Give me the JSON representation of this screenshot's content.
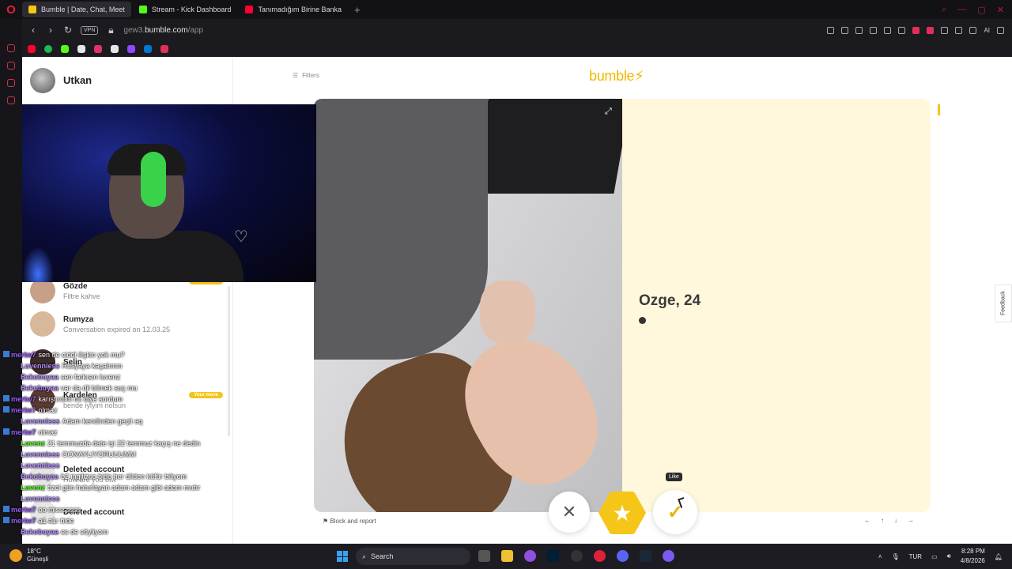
{
  "browser": {
    "tabs": [
      {
        "label": "Bumble | Date, Chat, Meet",
        "active": true,
        "color": "#f5c518"
      },
      {
        "label": "Stream - Kick Dashboard",
        "active": false,
        "color": "#53fc18"
      },
      {
        "label": "Tanımadığım Birine Banka",
        "active": false,
        "color": "#ff0033"
      }
    ],
    "vpn_label": "VPN",
    "url_prefix": "gew3.",
    "url_domain": "bumble.com",
    "url_path": "/app",
    "ai_label": "AI",
    "bookmark_colors": [
      "#ff0033",
      "#1db954",
      "#53fc18",
      "#e6e6ea",
      "#e1306c",
      "#e6e6ea",
      "#9146ff",
      "#0078d4",
      "#e0305a"
    ]
  },
  "sidebar": {
    "user_name": "Utkan",
    "conversations": [
      {
        "name": "Gözde",
        "sub": "Filtre kahve",
        "badge": "Your move"
      },
      {
        "name": "Rumyza",
        "sub": "Conversation expired on 12.03.25",
        "badge": ""
      },
      {
        "name": "Selin",
        "sub": "",
        "badge": ""
      },
      {
        "name": "Kardelen",
        "sub": "bende iyiyim nolsun",
        "badge": "Your move"
      },
      {
        "name": "Deleted account",
        "sub": "How are you btw",
        "badge": ""
      },
      {
        "name": "Deleted account",
        "sub": "",
        "badge": ""
      }
    ]
  },
  "chat_overlay": [
    {
      "user": "mertw7",
      "color": "#9b5cff",
      "msg": "sen de ciddi ilişkin yok mu?"
    },
    {
      "user": "Luvenniess",
      "color": "#b48cff",
      "msg": "Rusyaya kaçalımm"
    },
    {
      "user": "Bekobuyaa",
      "color": "#b48cff",
      "msg": "sen farkısın luvenz"
    },
    {
      "user": "Bekobuyaa",
      "color": "#b48cff",
      "msg": "var da dil bilmek suç mu"
    },
    {
      "user": "mertw7",
      "color": "#9b5cff",
      "msg": "karıştırdım mı diye sordum"
    },
    {
      "user": "mertw7",
      "color": "#9b5cff",
      "msg": "olmaz"
    },
    {
      "user": "Luvenniess",
      "color": "#b48cff",
      "msg": "Adam kendinden geçti aq"
    },
    {
      "user": "mertw7",
      "color": "#9b5cff",
      "msg": "olmaz"
    },
    {
      "user": "Luvenz",
      "color": "#53fc18",
      "msg": "21 temmuzda date işi 22 temmuz kaçış ne dedin"
    },
    {
      "user": "Luvenniess",
      "color": "#b48cff",
      "msg": "OONAYLIYORUUUMM"
    },
    {
      "user": "Luvenniess",
      "color": "#b48cff",
      "msg": ""
    },
    {
      "user": "Bekobuyaa",
      "color": "#b48cff",
      "msg": "b2 ingilizce bide her dilden küfür biliyom"
    },
    {
      "user": "Luvenz",
      "color": "#53fc18",
      "msg": "özel gün haturlayan adam adam gibi adam mıdır"
    },
    {
      "user": "Luvenniess",
      "color": "#b48cff",
      "msg": ""
    },
    {
      "user": "mertw7",
      "color": "#9b5cff",
      "msg": "oo misssssss"
    },
    {
      "user": "mertw7",
      "color": "#9b5cff",
      "msg": "a1 a1r bide"
    },
    {
      "user": "Bekobuyaa",
      "color": "#b48cff",
      "msg": "es de söyliyom"
    }
  ],
  "main": {
    "filters_label": "Filters",
    "logo_text": "bumble",
    "profile_name": "Ozge, 24",
    "feedback_label": "Feedback",
    "like_tooltip": "Like",
    "block_label": "Block and report",
    "pass_icon": "close-icon",
    "superswipe_icon": "star-icon",
    "like_icon": "check-icon",
    "kbd_hints": [
      "←",
      "↑",
      "↓",
      "→"
    ],
    "accent": "#f5c518",
    "panel_bg": "#fff8dc"
  },
  "taskbar": {
    "temperature": "18°C",
    "weather_label": "Güneşli",
    "search_placeholder": "Search",
    "lang": "TUR",
    "time": "8:28 PM",
    "date": "4/8/2026"
  }
}
